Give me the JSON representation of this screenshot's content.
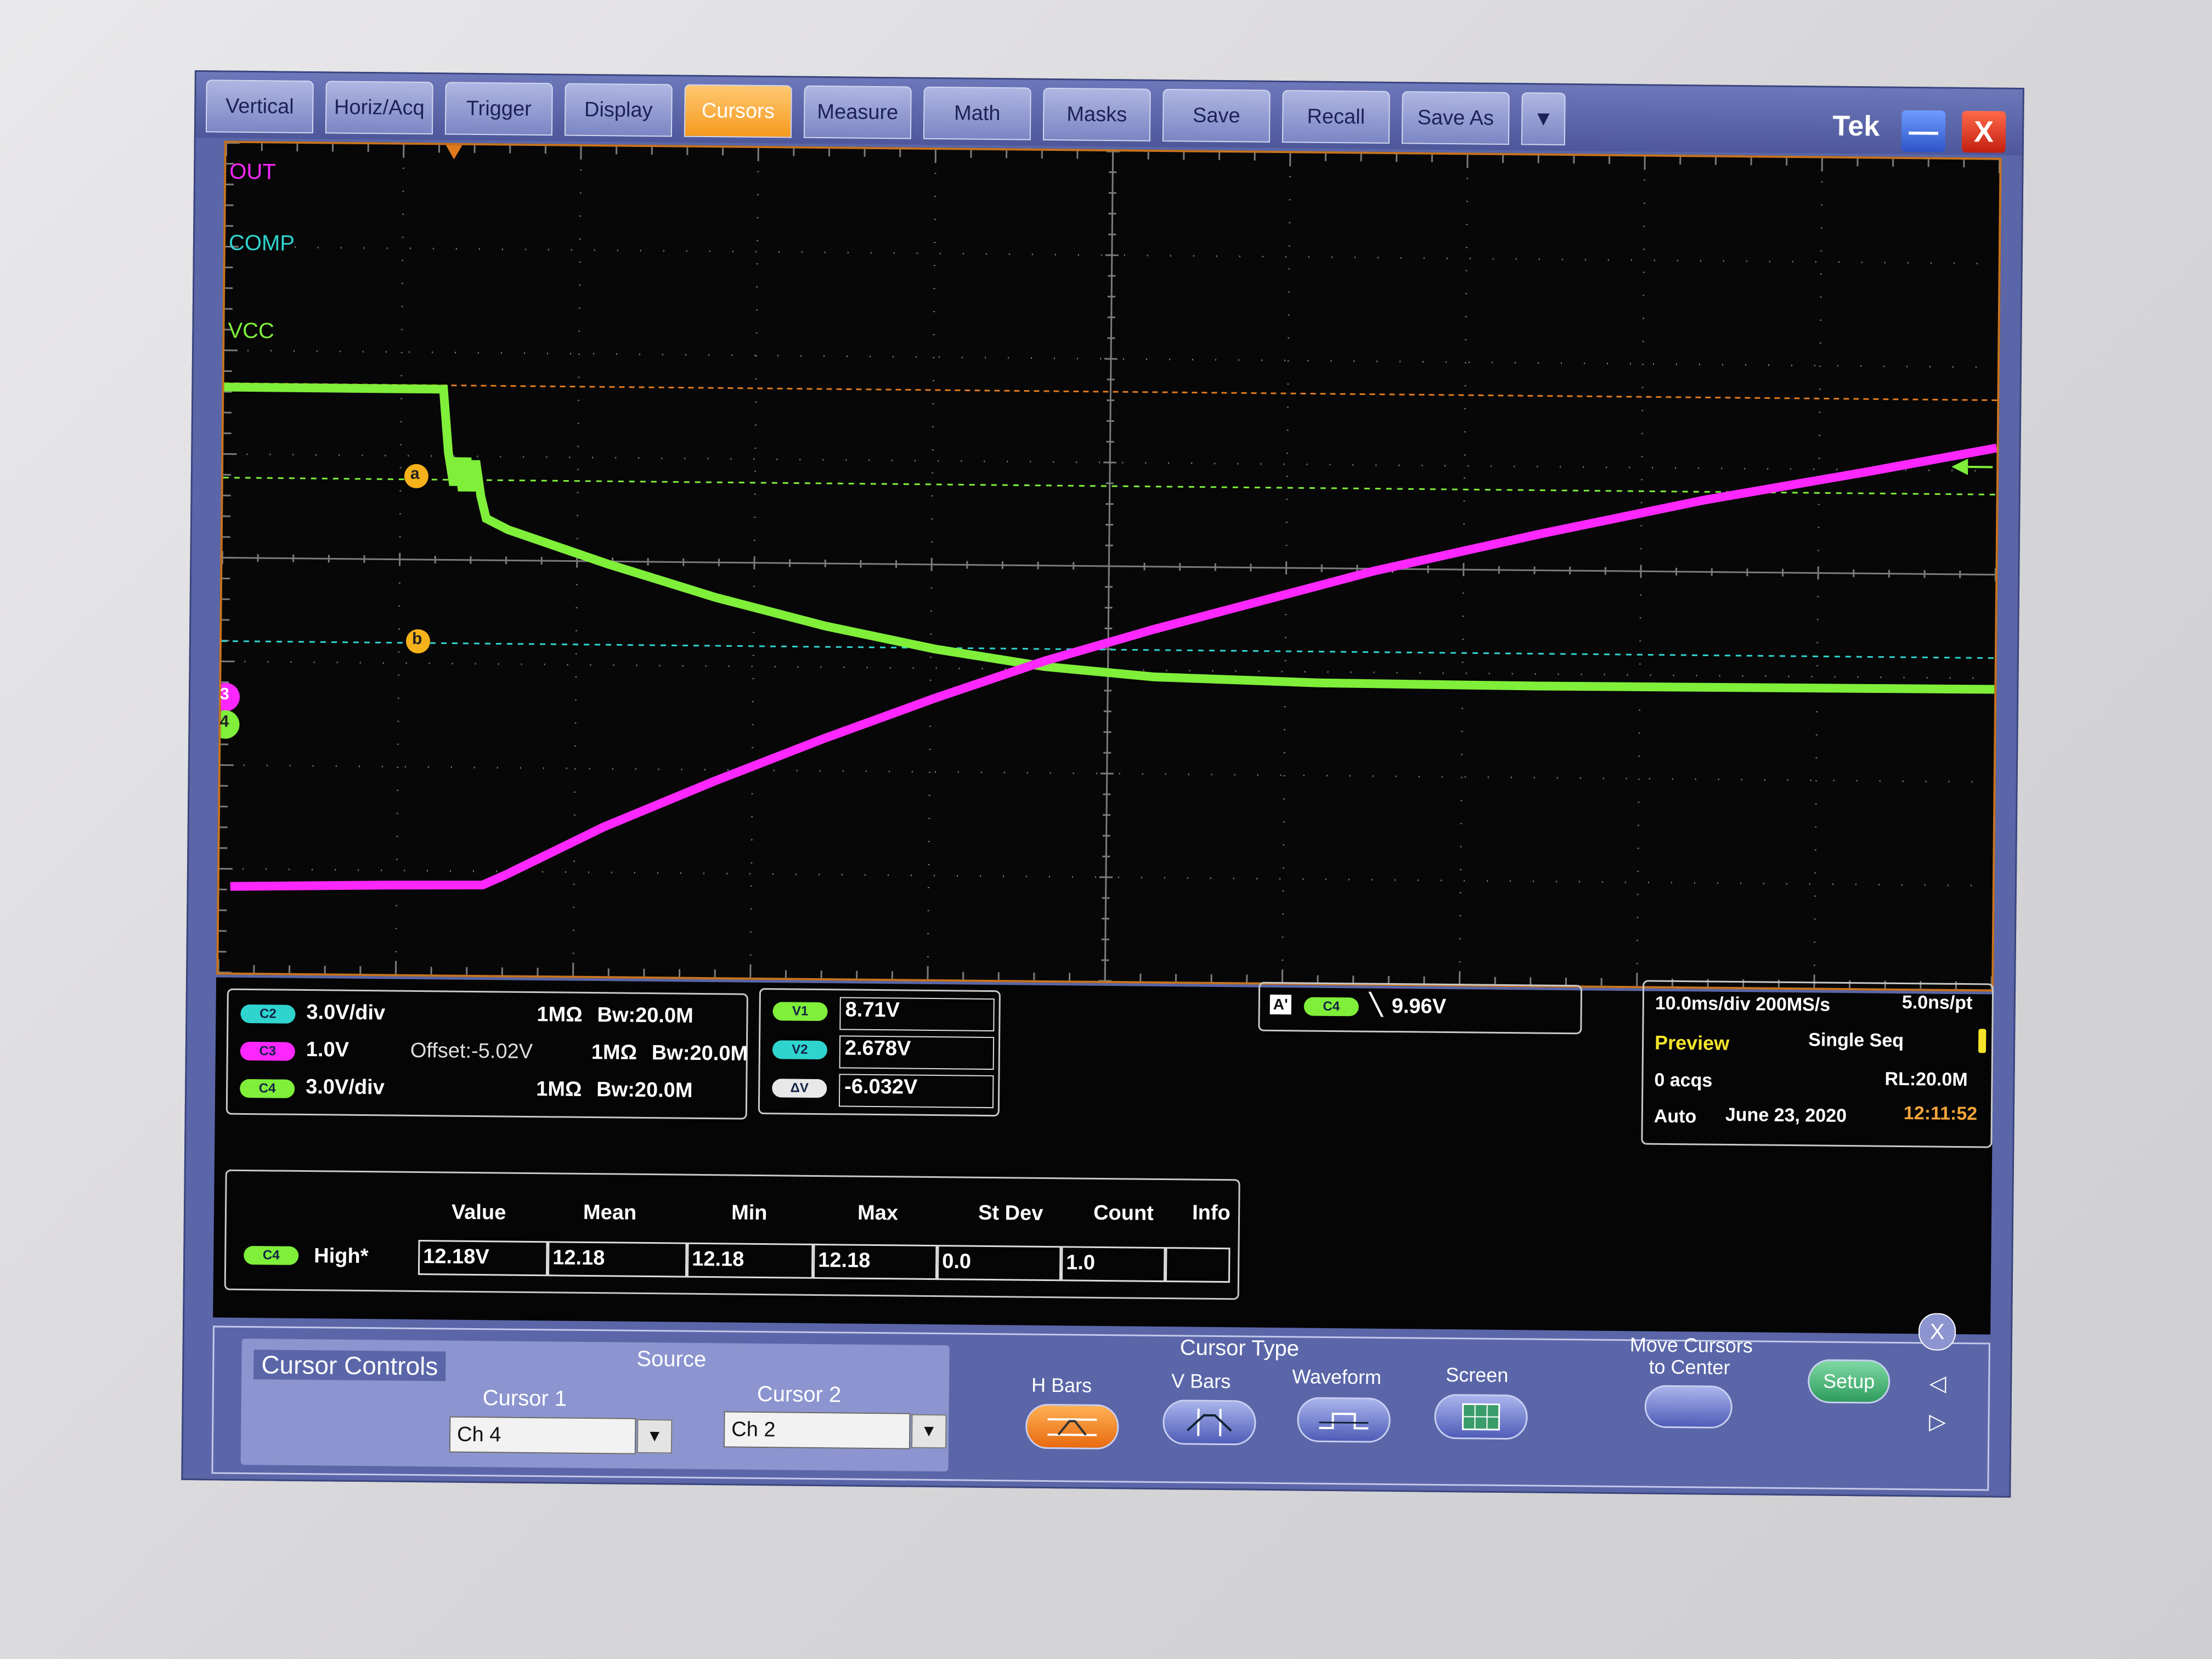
{
  "menu": {
    "tabs": [
      "Vertical",
      "Horiz/Acq",
      "Trigger",
      "Display",
      "Cursors",
      "Measure",
      "Math",
      "Masks",
      "Save",
      "Recall",
      "Save As"
    ],
    "active": "Cursors",
    "more_arrow": "▼",
    "brand": "Tek",
    "minimize_label": "—",
    "close_label": "X"
  },
  "graticule": {
    "channel_labels": {
      "out": "OUT",
      "comp": "COMP",
      "vcc": "VCC"
    },
    "cursor_a_label": "a",
    "cursor_b_label": "b",
    "ch3_marker": "3",
    "ch4_marker": "4",
    "colors": {
      "ch2": "#2fd4cf",
      "ch3": "#ff27ff",
      "ch4": "#7fef3a",
      "ch2_cursor": "#2fd4cf",
      "ch4_cursor": "#7fef3a",
      "trigger": "#e07a1f",
      "grid": "#7b7b7b"
    }
  },
  "channels": [
    {
      "pill": "C2",
      "scale": "3.0V/div",
      "offset": "",
      "impedance": "1MΩ",
      "bw": "Bw:20.0M",
      "color": "#2fd4cf"
    },
    {
      "pill": "C3",
      "scale": "1.0V",
      "offset": "Offset:-5.02V",
      "impedance": "1MΩ",
      "bw": "Bw:20.0M",
      "color": "#ff27ff"
    },
    {
      "pill": "C4",
      "scale": "3.0V/div",
      "offset": "",
      "impedance": "1MΩ",
      "bw": "Bw:20.0M",
      "color": "#7fef3a"
    }
  ],
  "cursor_readout": {
    "v1_label": "V1",
    "v1": "8.71V",
    "v2_label": "V2",
    "v2": "2.678V",
    "dv_label": "ΔV",
    "dv": "-6.032V"
  },
  "trigger": {
    "source_label": "A'",
    "channel": "C4",
    "slope": "╲",
    "level": "9.96V"
  },
  "acquisition": {
    "timebase": "10.0ms/div 200MS/s",
    "resolution": "5.0ns/pt",
    "mode": "Preview",
    "seq": "Single Seq",
    "acqs": "0 acqs",
    "record_length": "RL:20.0M",
    "trigger_mode": "Auto",
    "date": "June 23, 2020",
    "time": "12:11:52"
  },
  "measurement": {
    "headers": [
      "Value",
      "Mean",
      "Min",
      "Max",
      "St Dev",
      "Count",
      "Info"
    ],
    "channel": "C4",
    "name": "High*",
    "values": [
      "12.18V",
      "12.18",
      "12.18",
      "12.18",
      "0.0",
      "1.0",
      ""
    ]
  },
  "cursor_controls": {
    "title": "Cursor Controls",
    "source_label": "Source",
    "cursor1_label": "Cursor 1",
    "cursor1_value": "Ch 4",
    "cursor2_label": "Cursor 2",
    "cursor2_value": "Ch 2",
    "type_label": "Cursor Type",
    "types": [
      "H Bars",
      "V Bars",
      "Waveform",
      "Screen"
    ],
    "active_type": "H Bars",
    "move_label_1": "Move Cursors",
    "move_label_2": "to Center",
    "setup_label": "Setup",
    "close_label": "X"
  }
}
